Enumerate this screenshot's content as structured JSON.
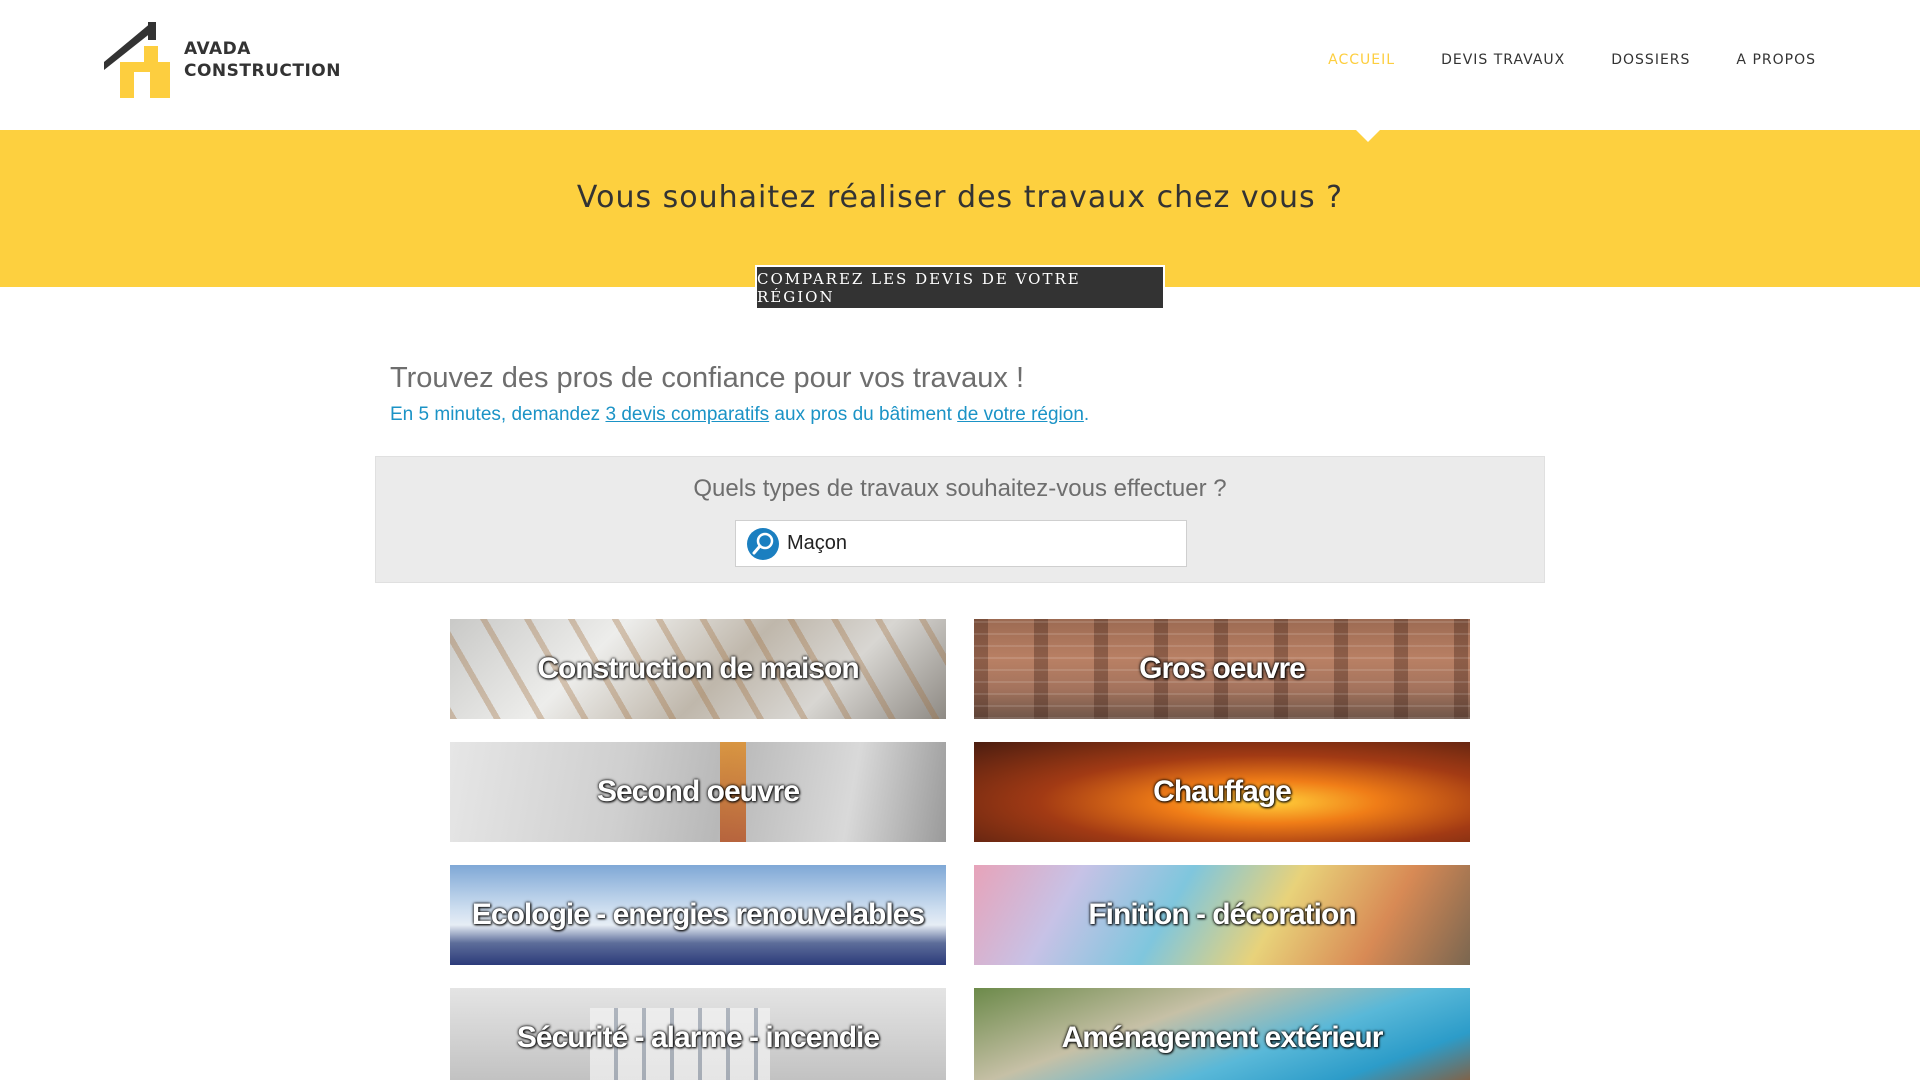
{
  "header": {
    "logo_line1": "AVADA",
    "logo_line2": "CONSTRUCTION",
    "nav": [
      {
        "label": "ACCUEIL",
        "active": true
      },
      {
        "label": "DEVIS TRAVAUX",
        "active": false
      },
      {
        "label": "DOSSIERS",
        "active": false
      },
      {
        "label": "A PROPOS",
        "active": false
      }
    ]
  },
  "hero": {
    "title": "Vous souhaitez réaliser des travaux chez vous ?",
    "cta_label": "COMPAREZ LES DEVIS DE VOTRE RÉGION"
  },
  "intro": {
    "title": "Trouvez des pros de confiance pour vos travaux !",
    "sub_part1": "En 5 minutes, demandez ",
    "sub_link1": "3 devis comparatifs",
    "sub_part2": " aux pros du bâtiment ",
    "sub_link2": "de votre région",
    "sub_part3": "."
  },
  "search": {
    "question": "Quels types de travaux souhaitez-vous effectuer ?",
    "value": "Maçon",
    "icon": "search-icon"
  },
  "tiles": [
    {
      "label": "Construction de maison"
    },
    {
      "label": "Gros oeuvre"
    },
    {
      "label": "Second oeuvre"
    },
    {
      "label": "Chauffage"
    },
    {
      "label": "Ecologie - energies renouvelables"
    },
    {
      "label": "Finition - décoration"
    },
    {
      "label": "Sécurité - alarme - incendie"
    },
    {
      "label": "Aménagement extérieur"
    }
  ],
  "colors": {
    "accent": "#fdce3f",
    "hero_bg": "#fdd03f",
    "link": "#1b93c6",
    "cta_bg": "#333333"
  }
}
